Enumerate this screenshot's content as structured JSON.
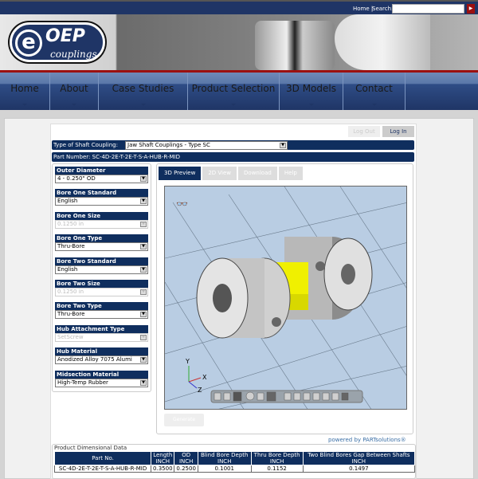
{
  "topbar": {
    "home": "Home |",
    "search_label": "Search:",
    "search_value": ""
  },
  "logo": {
    "text": "OEP couplings",
    "e": "e",
    "oep": "OEP",
    "couplings": "couplings"
  },
  "nav": [
    "Home",
    "About",
    "Case Studies",
    "Product Selection",
    "3D Models",
    "Contact"
  ],
  "auth": {
    "logout": "Log Out",
    "login": "Log In"
  },
  "coupling": {
    "label": "Type of Shaft Coupling:",
    "value": "Jaw Shaft Couplings - Type SC"
  },
  "part_number": "Part Number: SC-4D-2E-T-2E-T-S-A-HUB-R-MID",
  "fields": [
    {
      "label": "Outer Diameter",
      "value": "4 - 0.250\" OD",
      "disabled": false
    },
    {
      "label": "Bore One Standard",
      "value": "English",
      "disabled": false
    },
    {
      "label": "Bore One Size",
      "value": "0.1250 in",
      "disabled": true
    },
    {
      "label": "Bore One Type",
      "value": "Thru-Bore",
      "disabled": false
    },
    {
      "label": "Bore Two Standard",
      "value": "English",
      "disabled": false
    },
    {
      "label": "Bore Two Size",
      "value": "0.1250 in",
      "disabled": true
    },
    {
      "label": "Bore Two Type",
      "value": "Thru-Bore",
      "disabled": false
    },
    {
      "label": "Hub Attachment Type",
      "value": "SetScrew",
      "disabled": true
    },
    {
      "label": "Hub Material",
      "value": "Anodized Alloy 7075 Alumi",
      "disabled": false
    },
    {
      "label": "Midsection Material",
      "value": "High-Temp Rubber",
      "disabled": false
    }
  ],
  "tabs": [
    "3D Preview",
    "2D View",
    "Download",
    "Help"
  ],
  "axes": {
    "x": "X",
    "y": "Y",
    "z": "Z"
  },
  "generate": "Generate",
  "powered": "powered by PARTsolutions®",
  "table": {
    "title": "Product Dimensional Data",
    "headers": [
      [
        "Part No.",
        ""
      ],
      [
        "Length",
        "INCH"
      ],
      [
        "OD",
        "INCH"
      ],
      [
        "Blind Bore Depth",
        "INCH"
      ],
      [
        "Thru Bore Depth",
        "INCH"
      ],
      [
        "Two Blind Bores Gap Between Shafts",
        "INCH"
      ]
    ],
    "rows": [
      [
        "SC-4D-2E-T-2E-T-S-A-HUB-R-MID",
        "0.3500",
        "0.2500",
        "0.1001",
        "0.1152",
        "0.1497"
      ]
    ]
  },
  "colors": {
    "navy": "#0f2e5e",
    "accent_red": "#9b1010",
    "link": "#3a6ea5"
  }
}
